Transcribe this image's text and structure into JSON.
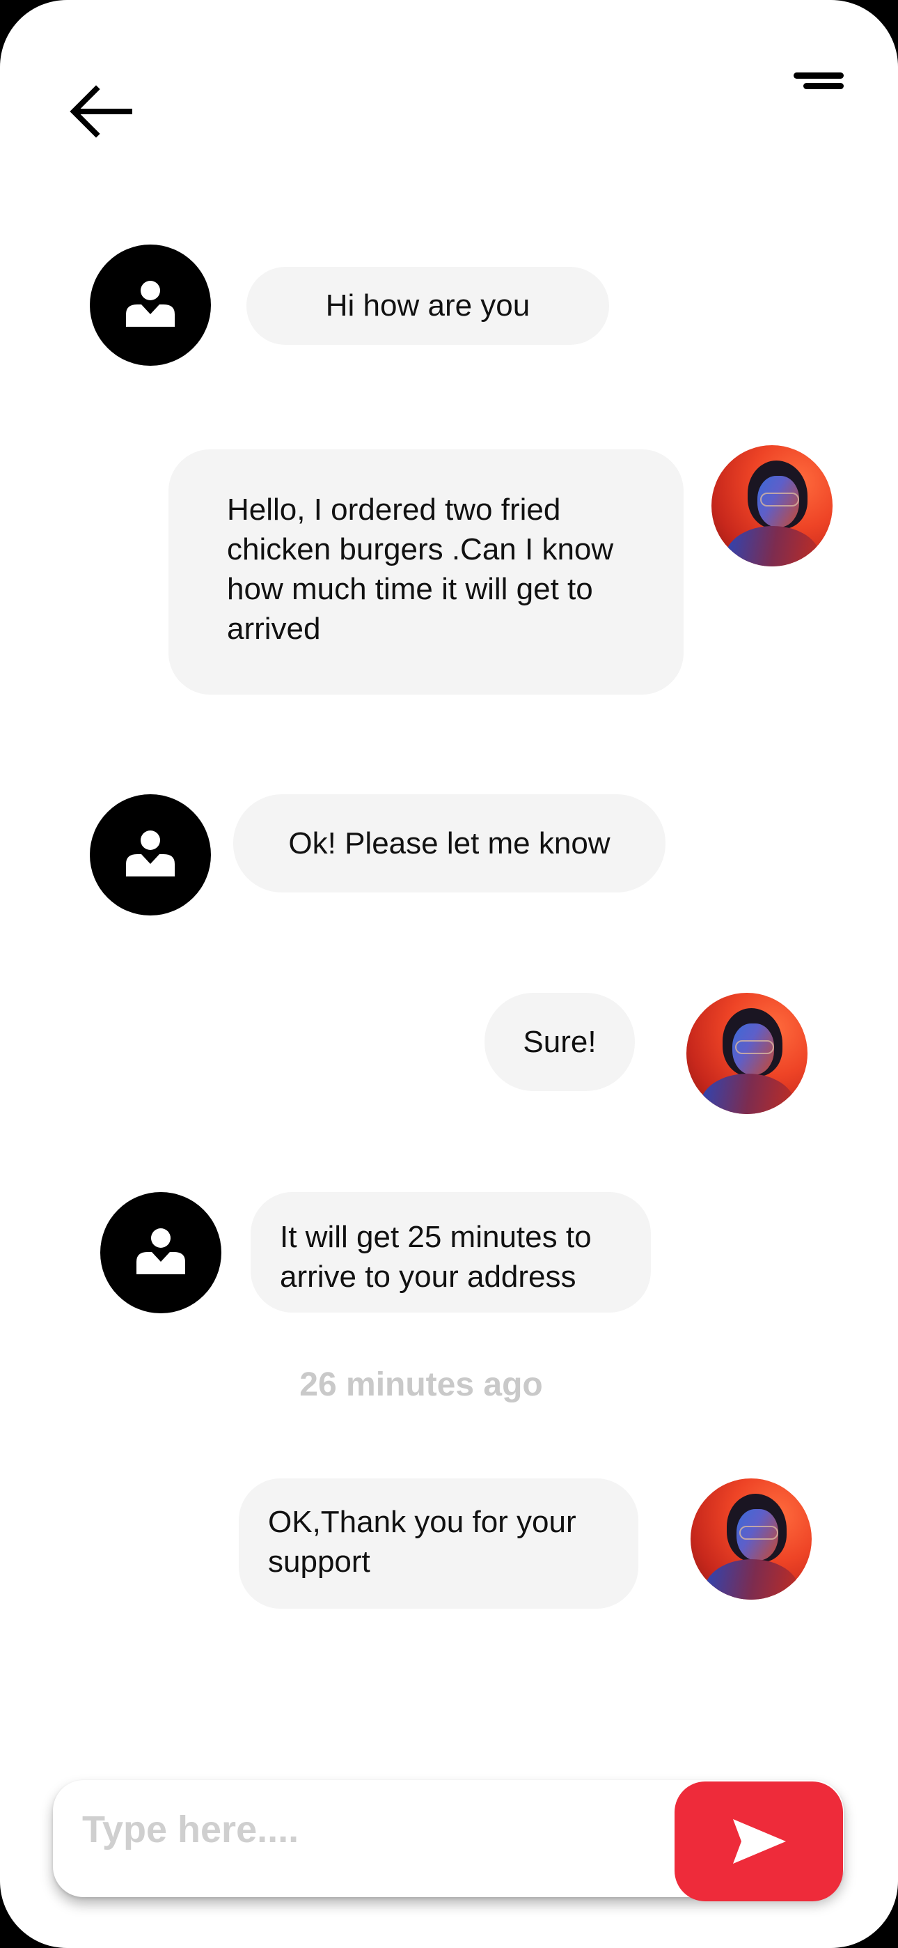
{
  "header": {
    "back_icon": "arrow-left-icon",
    "menu_icon": "menu-icon"
  },
  "messages": [
    {
      "sender": "agent",
      "text": "Hi how are you"
    },
    {
      "sender": "user",
      "text": "Hello, I ordered two fried chicken burgers .Can I know how much time it will get to arrived"
    },
    {
      "sender": "agent",
      "text": "Ok! Please let me know"
    },
    {
      "sender": "user",
      "text": "Sure!"
    },
    {
      "sender": "agent",
      "text": "It will get 25 minutes to arrive to your address"
    },
    {
      "sender": "user",
      "text": "OK,Thank you for your support"
    }
  ],
  "timestamp": "26 minutes ago",
  "composer": {
    "placeholder": "Type here....",
    "value": "",
    "send_icon": "send-icon"
  },
  "colors": {
    "accent": "#ee2b3a",
    "bubble": "#f4f4f4",
    "agent_avatar": "#000000",
    "timestamp": "#c9c9c9"
  }
}
